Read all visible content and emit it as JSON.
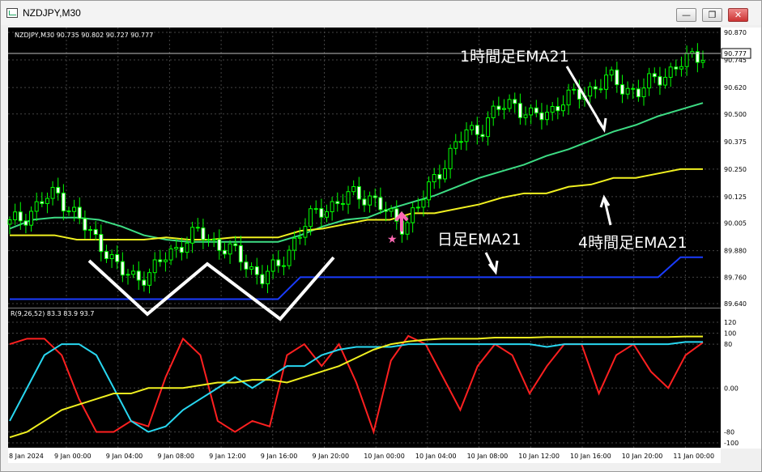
{
  "window": {
    "title": "NZDJPY,M30",
    "buttons": [
      "minimize",
      "restore",
      "close"
    ]
  },
  "chart_data": [
    {
      "type": "candlestick",
      "header": "NZDJPY,M30  90.735 90.802 90.727 90.777",
      "symbol": "NZDJPY",
      "timeframe": "M30",
      "ohlc_last": {
        "open": 90.735,
        "high": 90.802,
        "low": 90.727,
        "close": 90.777
      },
      "current_price_label": "90.777",
      "ylim": [
        89.64,
        90.87
      ],
      "y_tick_labels": [
        "90.870",
        "90.745",
        "90.620",
        "90.500",
        "90.375",
        "90.250",
        "90.125",
        "90.005",
        "89.880",
        "89.760",
        "89.640"
      ],
      "x_tick_labels": [
        "8 Jan 2024",
        "9 Jan 00:00",
        "9 Jan 04:00",
        "9 Jan 08:00",
        "9 Jan 12:00",
        "9 Jan 16:00",
        "9 Jan 20:00",
        "10 Jan 00:00",
        "10 Jan 04:00",
        "10 Jan 08:00",
        "10 Jan 12:00",
        "10 Jan 16:00",
        "10 Jan 20:00",
        "11 Jan 00:00"
      ],
      "grid": true,
      "series": [
        {
          "name": "1時間足EMA21",
          "color": "#3ddc84",
          "values": [
            89.98,
            90.02,
            90.03,
            90.03,
            90.02,
            89.99,
            89.95,
            89.93,
            89.92,
            89.92,
            89.92,
            89.92,
            89.92,
            89.95,
            89.99,
            90.02,
            90.03,
            90.07,
            90.1,
            90.13,
            90.17,
            90.21,
            90.24,
            90.27,
            90.31,
            90.34,
            90.38,
            90.42,
            90.45,
            90.49,
            90.52,
            90.55
          ]
        },
        {
          "name": "4時間足EMA21",
          "color": "#f0f020",
          "values": [
            89.95,
            89.95,
            89.95,
            89.93,
            89.93,
            89.93,
            89.93,
            89.94,
            89.93,
            89.93,
            89.94,
            89.94,
            89.94,
            89.97,
            89.98,
            90.0,
            90.02,
            90.02,
            90.05,
            90.05,
            90.07,
            90.09,
            90.12,
            90.14,
            90.14,
            90.17,
            90.18,
            90.21,
            90.21,
            90.23,
            90.25,
            90.25
          ]
        },
        {
          "name": "日足EMA21",
          "color": "#1a3cff",
          "values": [
            89.66,
            89.66,
            89.66,
            89.66,
            89.66,
            89.66,
            89.66,
            89.66,
            89.66,
            89.66,
            89.66,
            89.66,
            89.66,
            89.76,
            89.76,
            89.76,
            89.76,
            89.76,
            89.76,
            89.76,
            89.76,
            89.76,
            89.76,
            89.76,
            89.76,
            89.76,
            89.76,
            89.76,
            89.76,
            89.76,
            89.85,
            89.85
          ]
        }
      ],
      "price_path": [
        90.0,
        90.04,
        90.1,
        90.14,
        90.06,
        89.96,
        89.9,
        89.78,
        89.76,
        89.78,
        89.86,
        89.92,
        89.96,
        89.92,
        89.88,
        89.82,
        89.76,
        89.8,
        89.92,
        90.02,
        90.08,
        90.1,
        90.14,
        90.12,
        90.04,
        90.0,
        90.08,
        90.22,
        90.32,
        90.42,
        90.44,
        90.52,
        90.56,
        90.48,
        90.5,
        90.56,
        90.58,
        90.62,
        90.66,
        90.62,
        90.6,
        90.66,
        90.7,
        90.74,
        90.78
      ],
      "annotations": [
        {
          "text": "1時間足EMA21",
          "target_series": "1時間足EMA21"
        },
        {
          "text": "日足EMA21",
          "target_series": "日足EMA21"
        },
        {
          "text": "4時間足EMA21",
          "target_series": "4時間足EMA21"
        }
      ],
      "pattern_drawing": "W"
    },
    {
      "type": "line",
      "header": "R(9,26,52) 83.3 83.9 93.7",
      "ylim": [
        -100,
        120
      ],
      "y_tick_labels": [
        "120",
        "100",
        "80",
        "0.00",
        "-80",
        "-100"
      ],
      "series": [
        {
          "color": "#ff2020",
          "values": [
            80,
            90,
            90,
            60,
            -20,
            -80,
            -80,
            -60,
            -70,
            20,
            90,
            60,
            -60,
            -80,
            -60,
            -70,
            60,
            80,
            40,
            80,
            10,
            -80,
            50,
            95,
            80,
            20,
            -40,
            40,
            80,
            60,
            -10,
            40,
            80,
            80,
            -10,
            60,
            80,
            30,
            0,
            60,
            83
          ]
        },
        {
          "color": "#28d7f0",
          "values": [
            -60,
            0,
            60,
            80,
            80,
            60,
            0,
            -60,
            -80,
            -70,
            -40,
            -20,
            0,
            20,
            0,
            20,
            40,
            40,
            60,
            70,
            75,
            75,
            75,
            80,
            80,
            80,
            80,
            80,
            80,
            80,
            80,
            75,
            80,
            80,
            80,
            80,
            80,
            80,
            80,
            84,
            84
          ]
        },
        {
          "color": "#f0f020",
          "values": [
            -90,
            -80,
            -60,
            -40,
            -30,
            -20,
            -10,
            -10,
            0,
            0,
            0,
            5,
            10,
            10,
            15,
            15,
            10,
            20,
            30,
            40,
            55,
            70,
            80,
            85,
            88,
            90,
            90,
            90,
            92,
            92,
            92,
            93,
            93,
            93,
            93,
            93,
            93,
            93,
            93,
            94,
            94
          ]
        }
      ]
    }
  ]
}
